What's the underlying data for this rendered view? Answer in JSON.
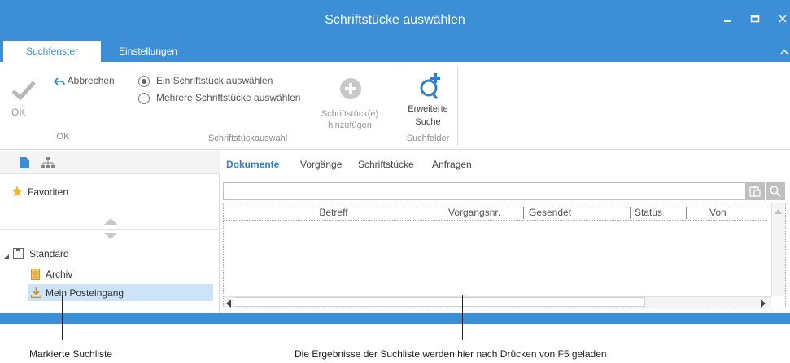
{
  "window": {
    "title": "Schriftstücke auswählen"
  },
  "tabs": [
    {
      "label": "Suchfenster",
      "active": true
    },
    {
      "label": "Einstellungen",
      "active": false
    }
  ],
  "ribbon": {
    "ok_label": "OK",
    "cancel_label": "Abbrechen",
    "group_ok": "OK",
    "radio_single": "Ein Schriftstück auswählen",
    "radio_multi": "Mehrere Schriftstücke auswählen",
    "add_docs_line1": "Schriftstück(e)",
    "add_docs_line2": "hinzufügen",
    "group_selection": "Schriftstückauswahl",
    "extended_line1": "Erweiterte",
    "extended_line2": "Suche",
    "group_searchfields": "Suchfelder"
  },
  "sidebar": {
    "favorites": "Favoriten",
    "standard": "Standard",
    "archive": "Archiv",
    "inbox": "Mein Posteingang"
  },
  "content": {
    "subtabs": [
      "Dokumente",
      "Vorgänge",
      "Schriftstücke",
      "Anfragen"
    ],
    "columns": [
      "Betreff",
      "Vorgangsnr.",
      "Gesendet",
      "Status",
      "Von"
    ]
  },
  "annotations": {
    "left": "Markierte Suchliste",
    "right": "Die Ergebnisse der Suchliste werden hier nach Drücken von F5 geladen"
  },
  "colors": {
    "accent": "#3c8fd6",
    "selection": "#cde3f7",
    "folder_icon": "#3c8fd6",
    "star": "#f2b830",
    "add_icon": "#2f7fc8"
  }
}
